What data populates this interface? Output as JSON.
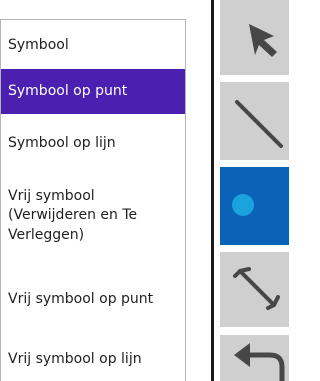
{
  "menu": {
    "items": [
      {
        "label": "Symbool",
        "selected": false
      },
      {
        "label": "Symbool op punt",
        "selected": true
      },
      {
        "label": "Symbool op lijn",
        "selected": false
      },
      {
        "label": "Vrij symbool (Verwijderen en Te Verleggen)",
        "selected": false
      },
      {
        "label": "Vrij symbool op punt",
        "selected": false
      },
      {
        "label": "Vrij symbool op lijn",
        "selected": false
      }
    ],
    "selected_color": "#4b1fb0"
  },
  "toolbar": {
    "tools": [
      {
        "icon": "select-arrow-icon",
        "active": false
      },
      {
        "icon": "line-icon",
        "active": false
      },
      {
        "icon": "point-icon",
        "active": true
      },
      {
        "icon": "resize-icon",
        "active": false
      },
      {
        "icon": "undo-icon",
        "active": false
      }
    ],
    "active_color": "#0a63b7",
    "point_color": "#1aa3dc",
    "button_color": "#cfcfcf"
  }
}
